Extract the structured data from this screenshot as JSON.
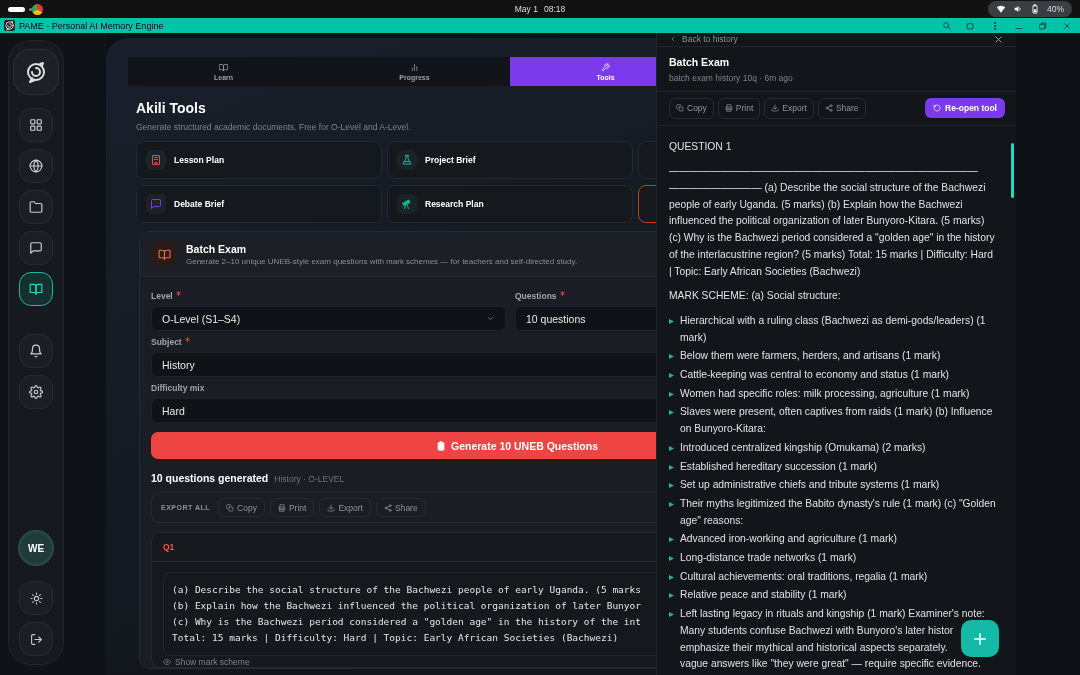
{
  "system_bar": {
    "date": "May 1",
    "time": "08:18",
    "battery": "40%"
  },
  "window": {
    "title": "PAME - Personal AI Memory Engine"
  },
  "nav_rail": {
    "items": [
      {
        "selected": false
      },
      {
        "selected": false
      },
      {
        "selected": false
      },
      {
        "selected": false
      },
      {
        "selected": true
      },
      {
        "selected": false
      },
      {
        "selected": false
      }
    ],
    "avatar": "WE"
  },
  "tabs": [
    {
      "label": "Learn",
      "selected": false
    },
    {
      "label": "Progress",
      "selected": false
    },
    {
      "label": "Tools",
      "selected": true
    }
  ],
  "tools": {
    "title": "Akili Tools",
    "subtitle": "Generate structured academic documents. Free for O-Level and A-Level.",
    "cards": [
      {
        "label": "Lesson Plan",
        "color": "#e0533d"
      },
      {
        "label": "Project Brief",
        "color": "#14b8a6"
      },
      {
        "label": "Debate Brief",
        "color": "#7c3aed"
      },
      {
        "label": "Research Plan",
        "color": "#10b981"
      }
    ]
  },
  "batch_exam": {
    "title": "Batch Exam",
    "description": "Generate 2–10 unique UNEB-style exam questions with mark schemes — for teachers and self-directed study.",
    "fields": [
      {
        "label": "Level",
        "required": true,
        "value": "O-Level (S1–S4)",
        "kind": "select"
      },
      {
        "label": "Questions",
        "required": true,
        "value": "10 questions",
        "kind": "text"
      },
      {
        "label": "Subject",
        "required": true,
        "value": "History",
        "kind": "text"
      },
      {
        "label": "Difficulty mix",
        "required": false,
        "value": "Hard",
        "kind": "text"
      }
    ],
    "generate_button": "Generate 10 UNEB Questions"
  },
  "results": {
    "title": "10 questions generated",
    "meta": "History · O-LEVEL",
    "export_label": "EXPORT ALL",
    "actions": [
      "Copy",
      "Print",
      "Export",
      "Share"
    ],
    "questions": [
      {
        "label": "Q1",
        "lines": [
          "(a) Describe the social structure of the Bachwezi people of early Uganda. (5 marks",
          "(b) Explain how the Bachwezi influenced the political organization of later Bunyor",
          "(c) Why is the Bachwezi period considered a \"golden age\" in the history of the int",
          "Total: 15 marks | Difficulty: Hard | Topic: Early African Societies (Bachwezi)"
        ],
        "toggle": "Show mark scheme"
      }
    ]
  },
  "drawer": {
    "back": "Back to history",
    "title": "Batch Exam",
    "meta": "batch exam history 10q · 6m ago",
    "actions": [
      "Copy",
      "Print",
      "Export",
      "Share"
    ],
    "reopen": "Re-open tool",
    "heading": "QUESTION 1",
    "rule": "——————————————————————————————",
    "question": "————————— (a) Describe the social structure of the Bachwezi people of early Uganda. (5 marks) (b) Explain how the Bachwezi influenced the political organization of later Bunyoro-Kitara. (5 marks) (c) Why is the Bachwezi period considered a \"golden age\" in the history of the interlacustrine region? (5 marks) Total: 15 marks | Difficulty: Hard | Topic: Early African Societies (Bachwezi)",
    "scheme_heading": "MARK SCHEME: (a) Social structure:",
    "bullets": [
      {
        "lines": [
          "Hierarchical with a ruling class (Bachwezi as demi-gods/leaders) (1 mark)"
        ]
      },
      {
        "lines": [
          "Below them were farmers, herders, and artisans (1 mark)"
        ]
      },
      {
        "lines": [
          "Cattle-keeping was central to economy and status (1 mark)"
        ]
      },
      {
        "lines": [
          "Women had specific roles: milk processing, agriculture (1 mark)"
        ]
      },
      {
        "lines": [
          "Slaves were present, often captives from raids (1 mark) (b) Influence on Bunyoro-Kitara:"
        ]
      },
      {
        "lines": [
          "Introduced centralized kingship (Omukama) (2 marks)"
        ]
      },
      {
        "lines": [
          "Established hereditary succession (1 mark)"
        ]
      },
      {
        "lines": [
          "Set up administrative chiefs and tribute systems (1 mark)"
        ]
      },
      {
        "lines": [
          "Their myths legitimized the Babito dynasty's rule (1 mark) (c) \"Golden age\" reasons:"
        ]
      },
      {
        "lines": [
          "Advanced iron-working and agriculture (1 mark)"
        ]
      },
      {
        "lines": [
          "Long-distance trade networks (1 mark)"
        ]
      },
      {
        "lines": [
          "Cultural achievements: oral traditions, regalia (1 mark)"
        ]
      },
      {
        "lines": [
          "Relative peace and stability (1 mark)"
        ]
      },
      {
        "lines": [
          "Left lasting legacy in rituals and kingship (1 mark) Examiner's note:",
          "Many students confuse Bachwezi with Bunyoro's later histor",
          "emphasize their mythical and historical aspects separately.",
          "vague answers like \"they were great\" — require specific evidence."
        ]
      }
    ]
  }
}
